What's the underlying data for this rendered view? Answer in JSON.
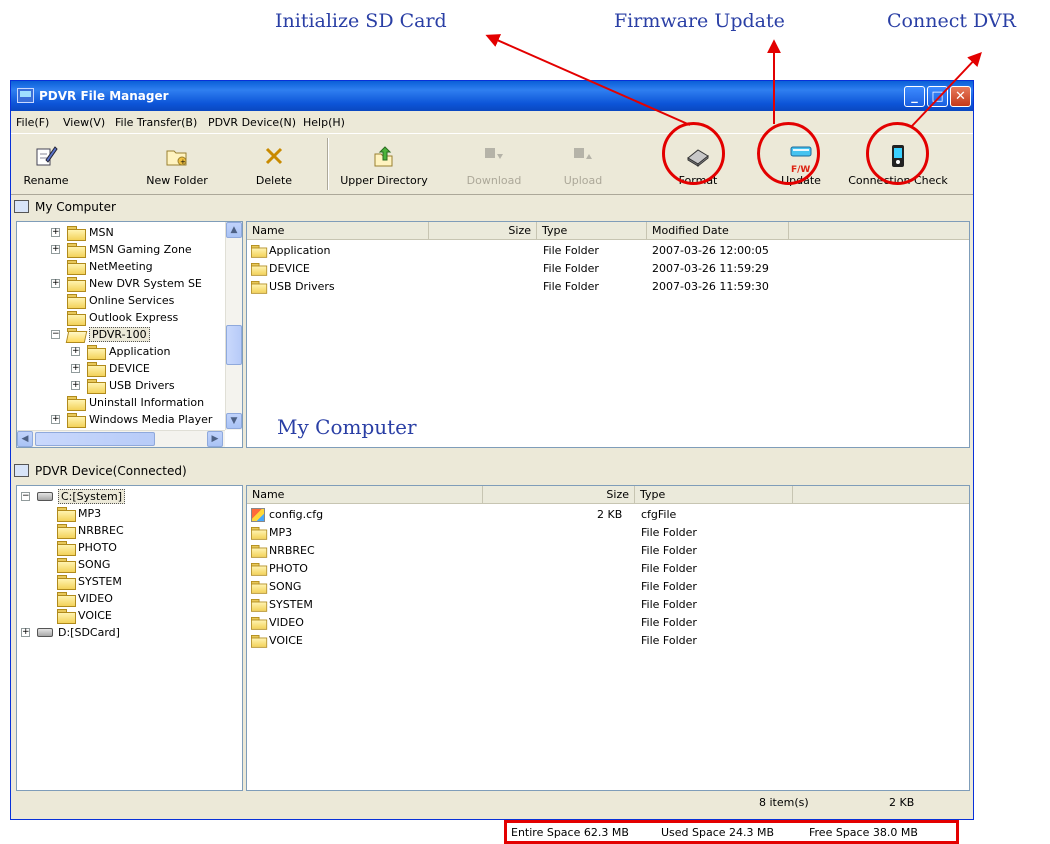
{
  "annotations": {
    "init_sd": "Initialize SD Card",
    "firmware": "Firmware Update",
    "connect": "Connect DVR",
    "my_computer_overlay": "My Computer"
  },
  "colors": {
    "annotation": "#2a3fa5",
    "highlight": "#e30000",
    "titlebar": "#0a5fd8"
  },
  "window": {
    "title": "PDVR File Manager"
  },
  "menu": [
    "File(F)",
    "View(V)",
    "File Transfer(B)",
    "PDVR Device(N)",
    "Help(H)"
  ],
  "toolbar": {
    "rename": "Rename",
    "new_folder": "New Folder",
    "delete": "Delete",
    "upper_directory": "Upper Directory",
    "download": "Download",
    "upload": "Upload",
    "format": "Format",
    "update": "Update",
    "update_badge": "F/W",
    "connection_check": "Connection Check"
  },
  "local_pane": {
    "header": "My Computer",
    "tree": [
      {
        "label": "MSN",
        "expander": "+"
      },
      {
        "label": "MSN Gaming Zone",
        "expander": "+"
      },
      {
        "label": "NetMeeting",
        "expander": ""
      },
      {
        "label": "New DVR System SE",
        "expander": "+"
      },
      {
        "label": "Online Services",
        "expander": ""
      },
      {
        "label": "Outlook Express",
        "expander": ""
      },
      {
        "label": "PDVR-100",
        "expander": "−"
      },
      {
        "label": "Application",
        "expander": "+"
      },
      {
        "label": "DEVICE",
        "expander": "+"
      },
      {
        "label": "USB Drivers",
        "expander": "+"
      },
      {
        "label": "Uninstall Information",
        "expander": ""
      },
      {
        "label": "Windows Media Player",
        "expander": "+"
      }
    ],
    "columns": [
      "Name",
      "Size",
      "Type",
      "Modified Date"
    ],
    "rows": [
      {
        "name": "Application",
        "size": "",
        "type": "File Folder",
        "date": "2007-03-26 12:00:05"
      },
      {
        "name": "DEVICE",
        "size": "",
        "type": "File Folder",
        "date": "2007-03-26 11:59:29"
      },
      {
        "name": "USB Drivers",
        "size": "",
        "type": "File Folder",
        "date": "2007-03-26 11:59:30"
      }
    ]
  },
  "device_pane": {
    "header": "PDVR Device(Connected)",
    "tree": [
      {
        "label": "C:[System]",
        "expander": "−",
        "kind": "drive"
      },
      {
        "label": "MP3",
        "expander": "",
        "kind": "folder"
      },
      {
        "label": "NRBREC",
        "expander": "",
        "kind": "folder"
      },
      {
        "label": "PHOTO",
        "expander": "",
        "kind": "folder"
      },
      {
        "label": "SONG",
        "expander": "",
        "kind": "folder"
      },
      {
        "label": "SYSTEM",
        "expander": "",
        "kind": "folder"
      },
      {
        "label": "VIDEO",
        "expander": "",
        "kind": "folder"
      },
      {
        "label": "VOICE",
        "expander": "",
        "kind": "folder"
      },
      {
        "label": "D:[SDCard]",
        "expander": "+",
        "kind": "drive"
      }
    ],
    "columns": [
      "Name",
      "Size",
      "Type"
    ],
    "rows": [
      {
        "name": "config.cfg",
        "size": "2 KB",
        "type": "cfgFile",
        "icon": "cfg-file-icon"
      },
      {
        "name": "MP3",
        "size": "",
        "type": "File Folder",
        "icon": "folder-icon"
      },
      {
        "name": "NRBREC",
        "size": "",
        "type": "File Folder",
        "icon": "folder-icon"
      },
      {
        "name": "PHOTO",
        "size": "",
        "type": "File Folder",
        "icon": "folder-icon"
      },
      {
        "name": "SONG",
        "size": "",
        "type": "File Folder",
        "icon": "folder-icon"
      },
      {
        "name": "SYSTEM",
        "size": "",
        "type": "File Folder",
        "icon": "folder-icon"
      },
      {
        "name": "VIDEO",
        "size": "",
        "type": "File Folder",
        "icon": "folder-icon"
      },
      {
        "name": "VOICE",
        "size": "",
        "type": "File Folder",
        "icon": "folder-icon"
      }
    ]
  },
  "status": {
    "item_count": "8 item(s)",
    "total_size": "2 KB",
    "entire_space": "Entire Space 62.3 MB",
    "used_space": "Used Space 24.3 MB",
    "free_space": "Free Space 38.0 MB"
  }
}
